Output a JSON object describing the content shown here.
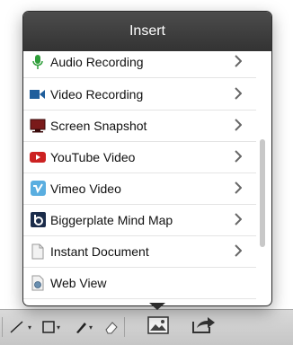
{
  "popover": {
    "title": "Insert",
    "items": [
      {
        "label": "Audio Recording",
        "icon": "microphone-icon",
        "has_chevron": true
      },
      {
        "label": "Video Recording",
        "icon": "video-camera-icon",
        "has_chevron": true
      },
      {
        "label": "Screen Snapshot",
        "icon": "screen-icon",
        "has_chevron": true
      },
      {
        "label": "YouTube Video",
        "icon": "youtube-icon",
        "has_chevron": true
      },
      {
        "label": "Vimeo Video",
        "icon": "vimeo-icon",
        "has_chevron": true
      },
      {
        "label": "Biggerplate Mind Map",
        "icon": "biggerplate-icon",
        "has_chevron": true
      },
      {
        "label": "Instant Document",
        "icon": "document-icon",
        "has_chevron": true
      },
      {
        "label": "Web View",
        "icon": "web-view-icon",
        "has_chevron": false
      }
    ]
  },
  "colors": {
    "header_bg": "#3b3b3b",
    "microphone": "#2f9e3a",
    "video": "#1f5e9c",
    "screen": "#7a1a1a",
    "youtube": "#cc2222",
    "vimeo": "#5aaee0",
    "biggerplate": "#1b2c4a"
  },
  "toolbar": {
    "icons": [
      "line-tool-icon",
      "shape-tool-icon",
      "pen-tool-icon",
      "eraser-icon",
      "image-icon",
      "share-icon"
    ]
  }
}
